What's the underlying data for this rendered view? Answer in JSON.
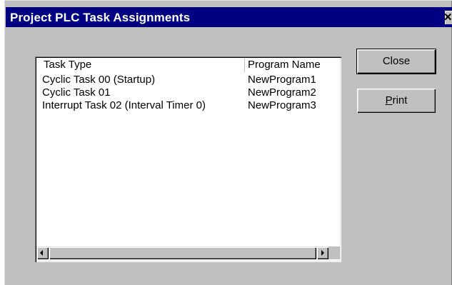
{
  "window": {
    "title": "Project PLC Task Assignments",
    "close_glyph": "✕"
  },
  "list": {
    "columns": [
      "Task Type",
      "Program Name"
    ],
    "rows": [
      {
        "task": "Cyclic Task 00 (Startup)",
        "program": "NewProgram1"
      },
      {
        "task": "Cyclic Task 01",
        "program": "NewProgram2"
      },
      {
        "task": "Interrupt Task 02 (Interval Timer 0)",
        "program": "NewProgram3"
      }
    ]
  },
  "buttons": {
    "close_label": "Close",
    "print_mnemonic": "P",
    "print_rest": "rint"
  },
  "colors": {
    "title_bar": "#000080",
    "face": "#c0c0c0"
  }
}
